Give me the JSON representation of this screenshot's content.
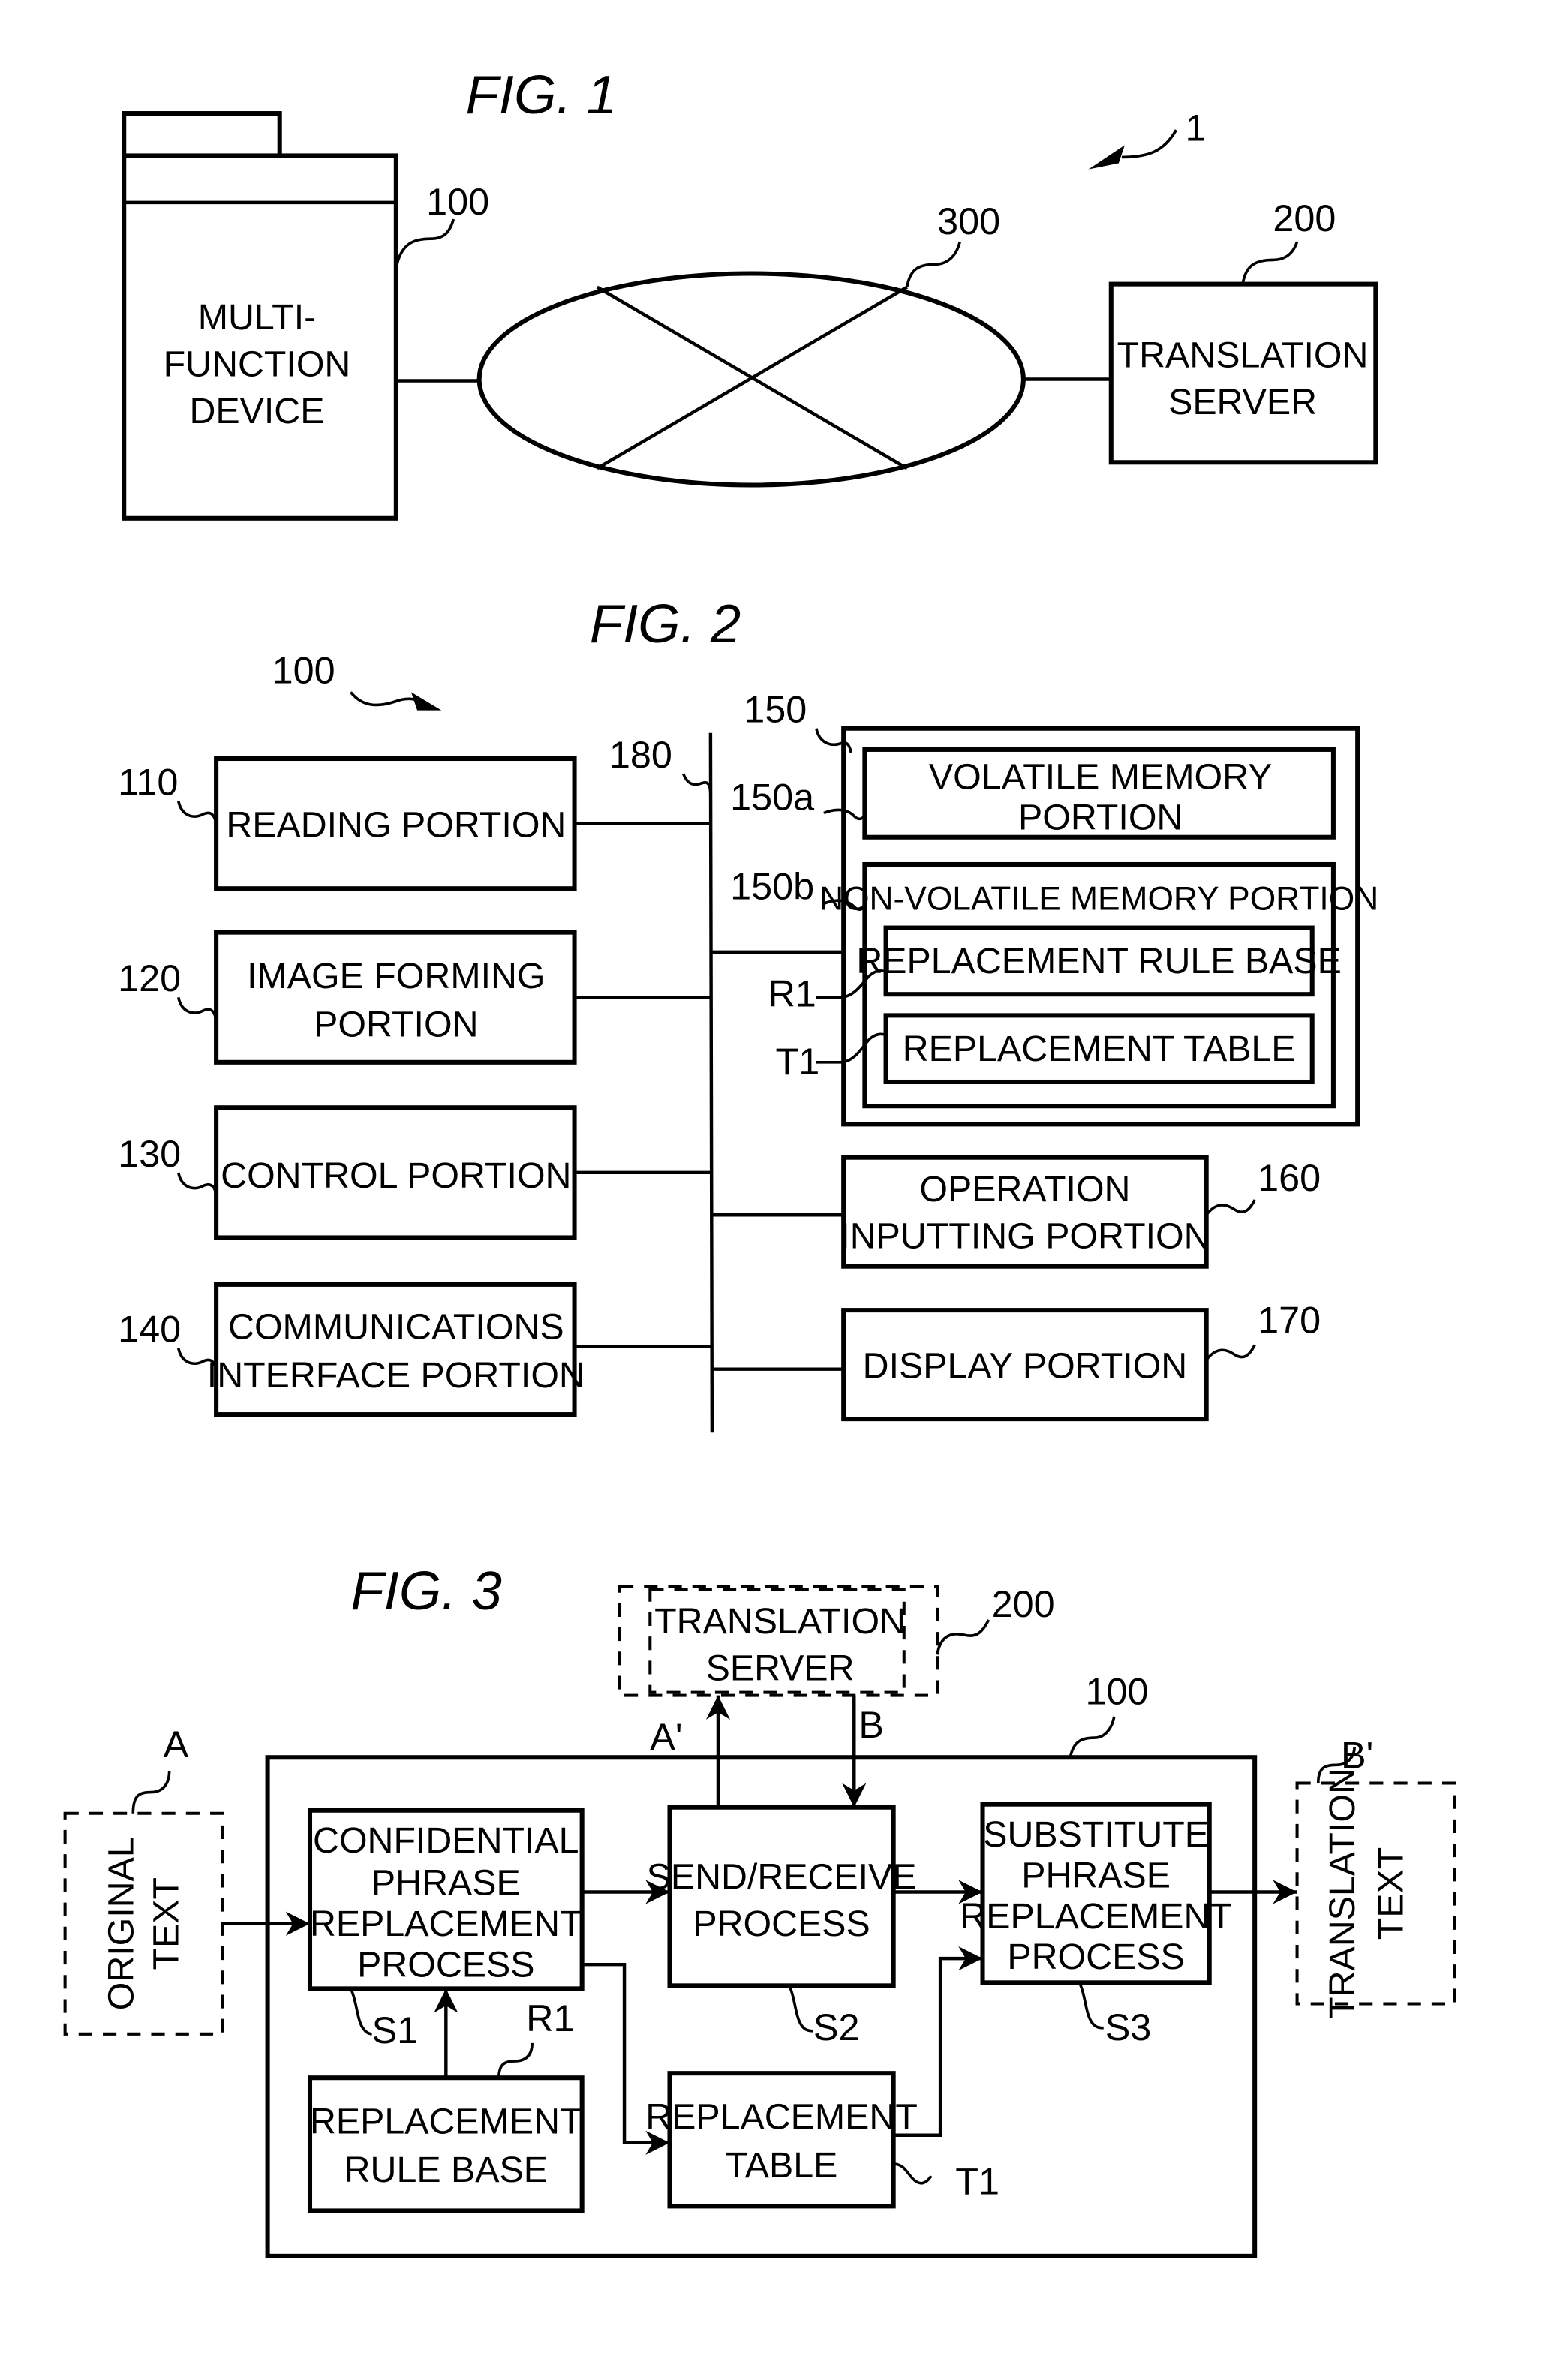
{
  "fig1": {
    "title": "FIG. 1",
    "system_ref": "1",
    "mfd": {
      "ref": "100",
      "lines": [
        "MULTI-",
        "FUNCTION",
        "DEVICE"
      ]
    },
    "network": {
      "ref": "300"
    },
    "server": {
      "ref": "200",
      "lines": [
        "TRANSLATION",
        "SERVER"
      ]
    }
  },
  "fig2": {
    "title": "FIG. 2",
    "device_ref": "100",
    "bus_ref": "180",
    "reading": {
      "ref": "110",
      "lines": [
        "READING PORTION"
      ]
    },
    "image_forming": {
      "ref": "120",
      "lines": [
        "IMAGE FORMING",
        "PORTION"
      ]
    },
    "control": {
      "ref": "130",
      "lines": [
        "CONTROL PORTION"
      ]
    },
    "comm": {
      "ref": "140",
      "lines": [
        "COMMUNICATIONS",
        "INTERFACE PORTION"
      ]
    },
    "memory": {
      "ref": "150"
    },
    "volatile": {
      "ref": "150a",
      "lines": [
        "VOLATILE MEMORY",
        "PORTION"
      ]
    },
    "nonvolatile": {
      "ref": "150b",
      "label": "NON-VOLATILE MEMORY PORTION"
    },
    "rule_base": {
      "ref": "R1",
      "label": "REPLACEMENT RULE BASE"
    },
    "table": {
      "ref": "T1",
      "label": "REPLACEMENT TABLE"
    },
    "operation": {
      "ref": "160",
      "lines": [
        "OPERATION",
        "INPUTTING PORTION"
      ]
    },
    "display": {
      "ref": "170",
      "lines": [
        "DISPLAY PORTION"
      ]
    }
  },
  "fig3": {
    "title": "FIG. 3",
    "server": {
      "ref": "200",
      "lines": [
        "TRANSLATION",
        "SERVER"
      ]
    },
    "device_ref": "100",
    "original": {
      "ref": "A",
      "lines": [
        "ORIGINAL",
        "TEXT"
      ]
    },
    "translation": {
      "ref": "B'",
      "lines": [
        "TRANSLATION",
        "TEXT"
      ]
    },
    "s1": {
      "ref": "S1",
      "lines": [
        "CONFIDENTIAL",
        "PHRASE",
        "REPLACEMENT",
        "PROCESS"
      ]
    },
    "s2": {
      "ref": "S2",
      "lines": [
        "SEND/RECEIVE",
        "PROCESS"
      ]
    },
    "s3": {
      "ref": "S3",
      "lines": [
        "SUBSTITUTE",
        "PHRASE",
        "REPLACEMENT",
        "PROCESS"
      ]
    },
    "rule_base": {
      "ref": "R1",
      "lines": [
        "REPLACEMENT",
        "RULE BASE"
      ]
    },
    "table": {
      "ref": "T1",
      "lines": [
        "REPLACEMENT",
        "TABLE"
      ]
    },
    "arrow_a_prime": "A'",
    "arrow_b": "B"
  }
}
